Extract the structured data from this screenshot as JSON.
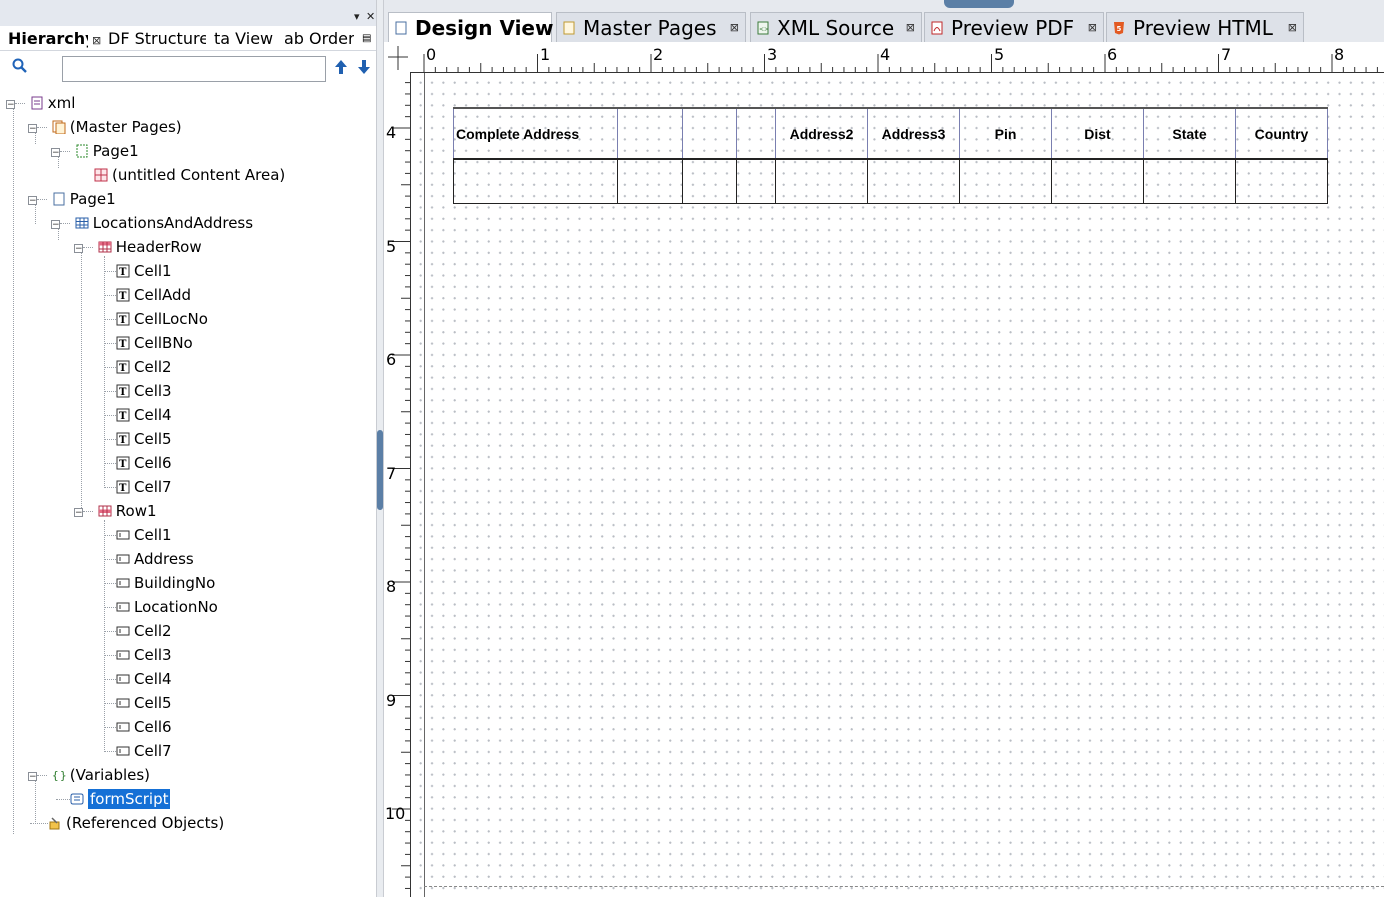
{
  "left_panel": {
    "tabs": [
      {
        "label": "Hierarchy",
        "active": true
      },
      {
        "label": "DF Structure"
      },
      {
        "label": "ta View"
      },
      {
        "label": "ab Order"
      }
    ],
    "search": {
      "value": "",
      "placeholder": ""
    },
    "tree": {
      "root": "xml",
      "master_pages": "(Master Pages)",
      "master_page1": "Page1",
      "content_area": "(untitled Content Area)",
      "page1": "Page1",
      "table": "LocationsAndAddress",
      "header_row": "HeaderRow",
      "header_cells": [
        "Cell1",
        "CellAdd",
        "CellLocNo",
        "CellBNo",
        "Cell2",
        "Cell3",
        "Cell4",
        "Cell5",
        "Cell6",
        "Cell7"
      ],
      "row1": "Row1",
      "row1_cells": [
        "Cell1",
        "Address",
        "BuildingNo",
        "LocationNo",
        "Cell2",
        "Cell3",
        "Cell4",
        "Cell5",
        "Cell6",
        "Cell7"
      ],
      "variables": "(Variables)",
      "form_script": "formScript",
      "referenced_objects": "(Referenced Objects)"
    }
  },
  "doc_tabs": [
    {
      "label": "Design View",
      "active": true,
      "icon": "page-icon"
    },
    {
      "label": "Master Pages",
      "icon": "master-page-icon"
    },
    {
      "label": "XML Source",
      "icon": "xml-icon"
    },
    {
      "label": "Preview PDF",
      "icon": "pdf-icon"
    },
    {
      "label": "Preview HTML",
      "icon": "html5-icon"
    }
  ],
  "ruler": {
    "horizontal": [
      "0",
      "1",
      "2",
      "3",
      "4",
      "5",
      "6",
      "7",
      "8"
    ],
    "vertical": [
      "4",
      "5",
      "6",
      "7",
      "8",
      "9",
      "10"
    ]
  },
  "design_table": {
    "headers": [
      "Complete Address",
      "",
      "",
      "",
      "Address2",
      "Address3",
      "Pin",
      "Dist",
      "State",
      "Country"
    ]
  },
  "colors": {
    "selection": "#1570d6",
    "accent_grip": "#5b7fa6"
  }
}
